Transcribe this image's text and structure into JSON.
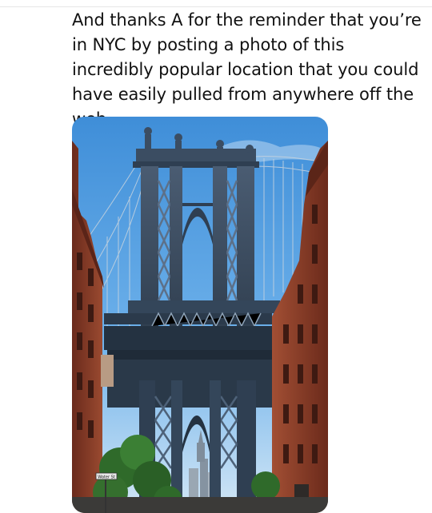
{
  "post": {
    "text": "And thanks A for the reminder that you’re in NYC by posting a photo of this incredibly popular location that you could have easily pulled from anywhere off the web."
  },
  "photo": {
    "street_sign_text": "Water St"
  },
  "colors": {
    "sky": "#4d9be0",
    "bridge_steel": "#3a4c60",
    "brick_left": "#8a3b27",
    "brick_right": "#7e3424",
    "foliage": "#2f6a2a"
  }
}
